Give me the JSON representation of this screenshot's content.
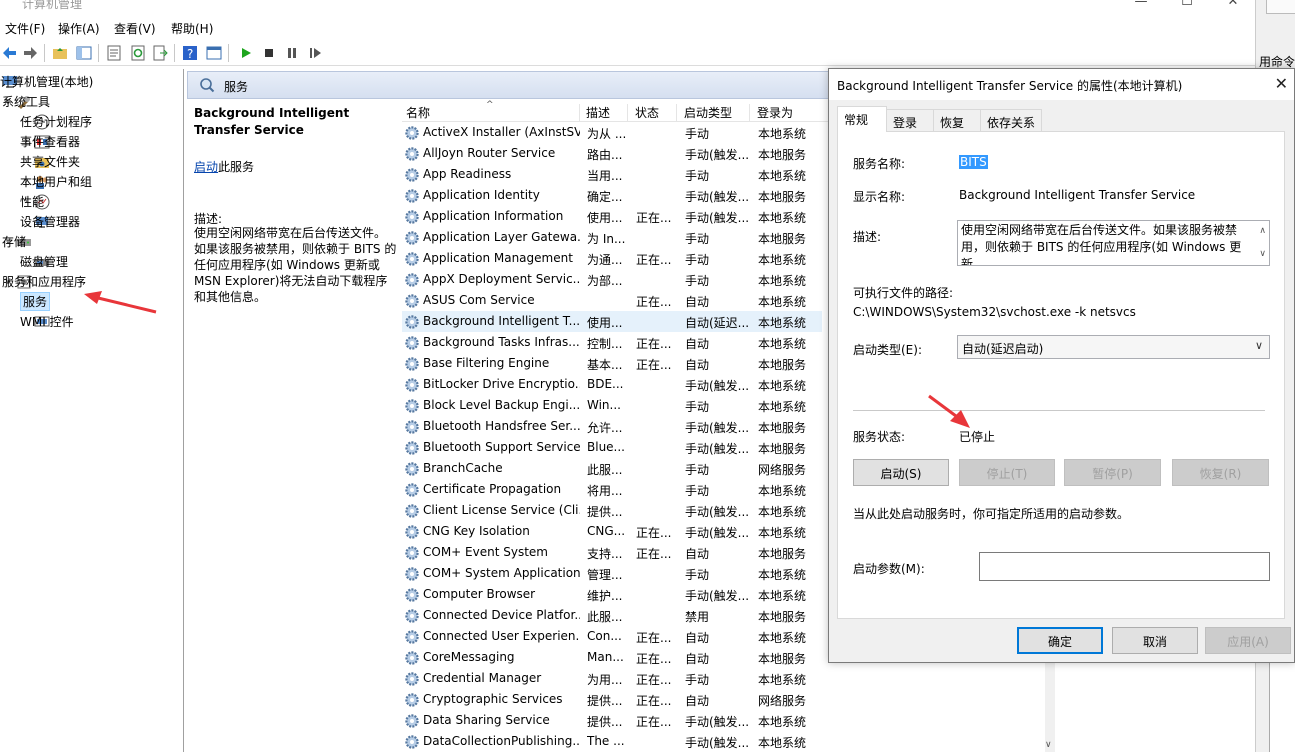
{
  "window": {
    "title": "计算机管理",
    "minimize": "—",
    "maximize": "☐",
    "close": "✕"
  },
  "menu": [
    "文件(F)",
    "操作(A)",
    "查看(V)",
    "帮助(H)"
  ],
  "back_window_text": "用命令",
  "tree": {
    "root": "计算机管理(本地)",
    "system_tools": "系统工具",
    "task_scheduler": "任务计划程序",
    "event_viewer": "事件查看器",
    "shared_folders": "共享文件夹",
    "local_users": "本地用户和组",
    "performance": "性能",
    "device_manager": "设备管理器",
    "storage": "存储",
    "disk_mgmt": "磁盘管理",
    "services_apps": "服务和应用程序",
    "services": "服务",
    "wmi": "WMI 控件"
  },
  "panel": {
    "header": "服务",
    "selected_title": "Background Intelligent Transfer Service",
    "start_link": "启动",
    "start_suffix": "此服务",
    "desc_label": "描述:",
    "desc_text": "使用空闲网络带宽在后台传送文件。如果该服务被禁用，则依赖于 BITS 的任何应用程序(如 Windows 更新或 MSN Explorer)将无法自动下载程序和其他信息。"
  },
  "columns": [
    "名称",
    "描述",
    "状态",
    "启动类型",
    "登录为"
  ],
  "services": [
    {
      "name": "ActiveX Installer (AxInstSV)",
      "desc": "为从 ...",
      "status": "",
      "start": "手动",
      "logon": "本地系统"
    },
    {
      "name": "AllJoyn Router Service",
      "desc": "路由...",
      "status": "",
      "start": "手动(触发...",
      "logon": "本地服务"
    },
    {
      "name": "App Readiness",
      "desc": "当用...",
      "status": "",
      "start": "手动",
      "logon": "本地系统"
    },
    {
      "name": "Application Identity",
      "desc": "确定...",
      "status": "",
      "start": "手动(触发...",
      "logon": "本地服务"
    },
    {
      "name": "Application Information",
      "desc": "使用...",
      "status": "正在...",
      "start": "手动(触发...",
      "logon": "本地系统"
    },
    {
      "name": "Application Layer Gatewa...",
      "desc": "为 In...",
      "status": "",
      "start": "手动",
      "logon": "本地服务"
    },
    {
      "name": "Application Management",
      "desc": "为通...",
      "status": "正在...",
      "start": "手动",
      "logon": "本地系统"
    },
    {
      "name": "AppX Deployment Servic...",
      "desc": "为部...",
      "status": "",
      "start": "手动",
      "logon": "本地系统"
    },
    {
      "name": "ASUS Com Service",
      "desc": "",
      "status": "正在...",
      "start": "自动",
      "logon": "本地系统"
    },
    {
      "name": "Background Intelligent T...",
      "desc": "使用...",
      "status": "",
      "start": "自动(延迟...",
      "logon": "本地系统"
    },
    {
      "name": "Background Tasks Infras...",
      "desc": "控制...",
      "status": "正在...",
      "start": "自动",
      "logon": "本地系统"
    },
    {
      "name": "Base Filtering Engine",
      "desc": "基本...",
      "status": "正在...",
      "start": "自动",
      "logon": "本地服务"
    },
    {
      "name": "BitLocker Drive Encryptio...",
      "desc": "BDE...",
      "status": "",
      "start": "手动(触发...",
      "logon": "本地系统"
    },
    {
      "name": "Block Level Backup Engi...",
      "desc": "Win...",
      "status": "",
      "start": "手动",
      "logon": "本地系统"
    },
    {
      "name": "Bluetooth Handsfree Ser...",
      "desc": "允许...",
      "status": "",
      "start": "手动(触发...",
      "logon": "本地服务"
    },
    {
      "name": "Bluetooth Support Service",
      "desc": "Blue...",
      "status": "",
      "start": "手动(触发...",
      "logon": "本地服务"
    },
    {
      "name": "BranchCache",
      "desc": "此服...",
      "status": "",
      "start": "手动",
      "logon": "网络服务"
    },
    {
      "name": "Certificate Propagation",
      "desc": "将用...",
      "status": "",
      "start": "手动",
      "logon": "本地系统"
    },
    {
      "name": "Client License Service (Cli...",
      "desc": "提供...",
      "status": "",
      "start": "手动(触发...",
      "logon": "本地系统"
    },
    {
      "name": "CNG Key Isolation",
      "desc": "CNG...",
      "status": "正在...",
      "start": "手动(触发...",
      "logon": "本地系统"
    },
    {
      "name": "COM+ Event System",
      "desc": "支持...",
      "status": "正在...",
      "start": "自动",
      "logon": "本地服务"
    },
    {
      "name": "COM+ System Application",
      "desc": "管理...",
      "status": "",
      "start": "手动",
      "logon": "本地系统"
    },
    {
      "name": "Computer Browser",
      "desc": "维护...",
      "status": "",
      "start": "手动(触发...",
      "logon": "本地系统"
    },
    {
      "name": "Connected Device Platfor...",
      "desc": "此服...",
      "status": "",
      "start": "禁用",
      "logon": "本地服务"
    },
    {
      "name": "Connected User Experien...",
      "desc": "Con...",
      "status": "正在...",
      "start": "自动",
      "logon": "本地系统"
    },
    {
      "name": "CoreMessaging",
      "desc": "Man...",
      "status": "正在...",
      "start": "自动",
      "logon": "本地服务"
    },
    {
      "name": "Credential Manager",
      "desc": "为用...",
      "status": "正在...",
      "start": "手动",
      "logon": "本地系统"
    },
    {
      "name": "Cryptographic Services",
      "desc": "提供...",
      "status": "正在...",
      "start": "自动",
      "logon": "网络服务"
    },
    {
      "name": "Data Sharing Service",
      "desc": "提供...",
      "status": "正在...",
      "start": "手动(触发...",
      "logon": "本地系统"
    },
    {
      "name": "DataCollectionPublishing...",
      "desc": "The ...",
      "status": "",
      "start": "手动(触发...",
      "logon": "本地系统"
    }
  ],
  "dialog": {
    "title": "Background Intelligent Transfer Service 的属性(本地计算机)",
    "close": "✕",
    "tabs": [
      "常规",
      "登录",
      "恢复",
      "依存关系"
    ],
    "service_name_label": "服务名称:",
    "service_name": "BITS",
    "display_name_label": "显示名称:",
    "display_name": "Background Intelligent Transfer Service",
    "desc_label": "描述:",
    "desc_text": "使用空闲网络带宽在后台传送文件。如果该服务被禁用，则依赖于 BITS 的任何应用程序(如 Windows 更新",
    "path_label": "可执行文件的路径:",
    "path": "C:\\WINDOWS\\System32\\svchost.exe -k netsvcs",
    "start_type_label": "启动类型(E):",
    "start_type": "自动(延迟启动)",
    "status_label": "服务状态:",
    "status": "已停止",
    "btn_start": "启动(S)",
    "btn_stop": "停止(T)",
    "btn_pause": "暂停(P)",
    "btn_resume": "恢复(R)",
    "hint": "当从此处启动服务时，你可指定所适用的启动参数。",
    "param_label": "启动参数(M):",
    "param_value": "",
    "ok": "确定",
    "cancel": "取消",
    "apply": "应用(A)"
  },
  "colors": {
    "accent": "#0078d7",
    "selection": "#cce8ff",
    "annotation": "#e8363a"
  }
}
